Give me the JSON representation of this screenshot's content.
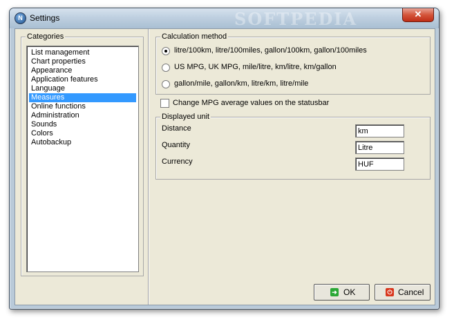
{
  "window": {
    "title": "Settings",
    "watermark": "SOFTPEDIA",
    "close_label": "✕"
  },
  "categories": {
    "legend": "Categories",
    "items": [
      {
        "label": "List management",
        "selected": false
      },
      {
        "label": "Chart properties",
        "selected": false
      },
      {
        "label": "Appearance",
        "selected": false
      },
      {
        "label": "Application features",
        "selected": false
      },
      {
        "label": "Language",
        "selected": false
      },
      {
        "label": "Measures",
        "selected": true
      },
      {
        "label": "Online functions",
        "selected": false
      },
      {
        "label": "Administration",
        "selected": false
      },
      {
        "label": "Sounds",
        "selected": false
      },
      {
        "label": "Colors",
        "selected": false
      },
      {
        "label": "Autobackup",
        "selected": false
      }
    ]
  },
  "calculation": {
    "legend": "Calculation method",
    "options": [
      {
        "label": "litre/100km, litre/100miles, gallon/100km, gallon/100miles",
        "checked": true
      },
      {
        "label": "US MPG, UK MPG, mile/litre, km/litre, km/gallon",
        "checked": false
      },
      {
        "label": "gallon/mile, gallon/km, litre/km, litre/mile",
        "checked": false
      }
    ]
  },
  "statusbar_checkbox": {
    "label": "Change MPG average values on the statusbar",
    "checked": false
  },
  "displayed_unit": {
    "legend": "Displayed unit",
    "distance": {
      "label": "Distance",
      "value": "km"
    },
    "quantity": {
      "label": "Quantity",
      "value": "Litre"
    },
    "currency": {
      "label": "Currency",
      "value": "HUF"
    }
  },
  "buttons": {
    "ok": "OK",
    "cancel": "Cancel"
  },
  "colors": {
    "selection": "#3399ff",
    "dialog_face": "#ece9d8",
    "ok_icon": "#2aa836",
    "cancel_icon": "#d8361c"
  },
  "icons": {
    "app": "app-logo-icon",
    "ok": "check-arrow-icon",
    "cancel": "power-cancel-icon"
  }
}
